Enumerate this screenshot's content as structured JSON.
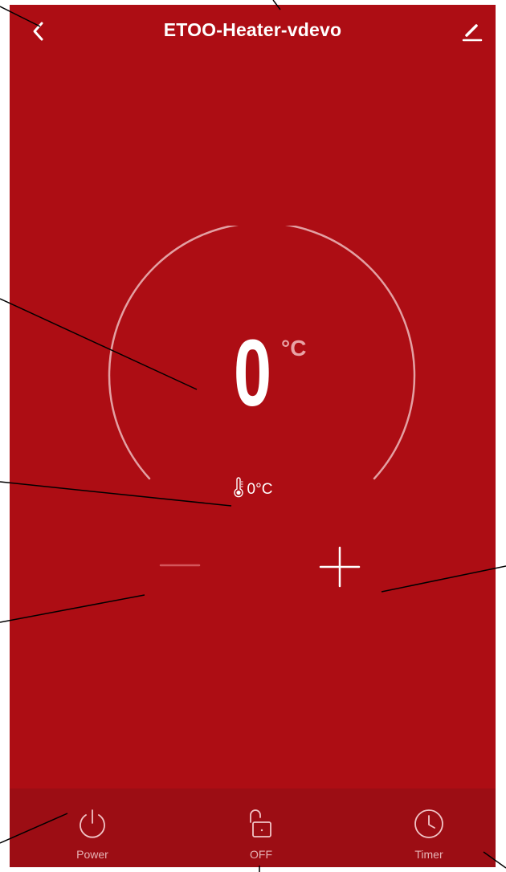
{
  "header": {
    "title": "ETOO-Heater-vdevo",
    "back_icon": "chevron-left-icon",
    "edit_icon": "pencil-icon"
  },
  "thermostat": {
    "set_temperature": "0",
    "unit": "°C",
    "current_temperature": "0°C",
    "current_icon": "thermometer-icon"
  },
  "controls": {
    "decrease_icon": "minus-icon",
    "increase_icon": "plus-icon"
  },
  "bottom_bar": {
    "items": [
      {
        "label": "Power",
        "icon": "power-icon"
      },
      {
        "label": "OFF",
        "icon": "unlocked-padlock-icon"
      },
      {
        "label": "Timer",
        "icon": "clock-icon"
      }
    ]
  },
  "colors": {
    "background": "#ad0d14",
    "bottom_bar": "#9c0d14",
    "foreground": "#ffffff",
    "dimmed": "#e8a3a6"
  }
}
